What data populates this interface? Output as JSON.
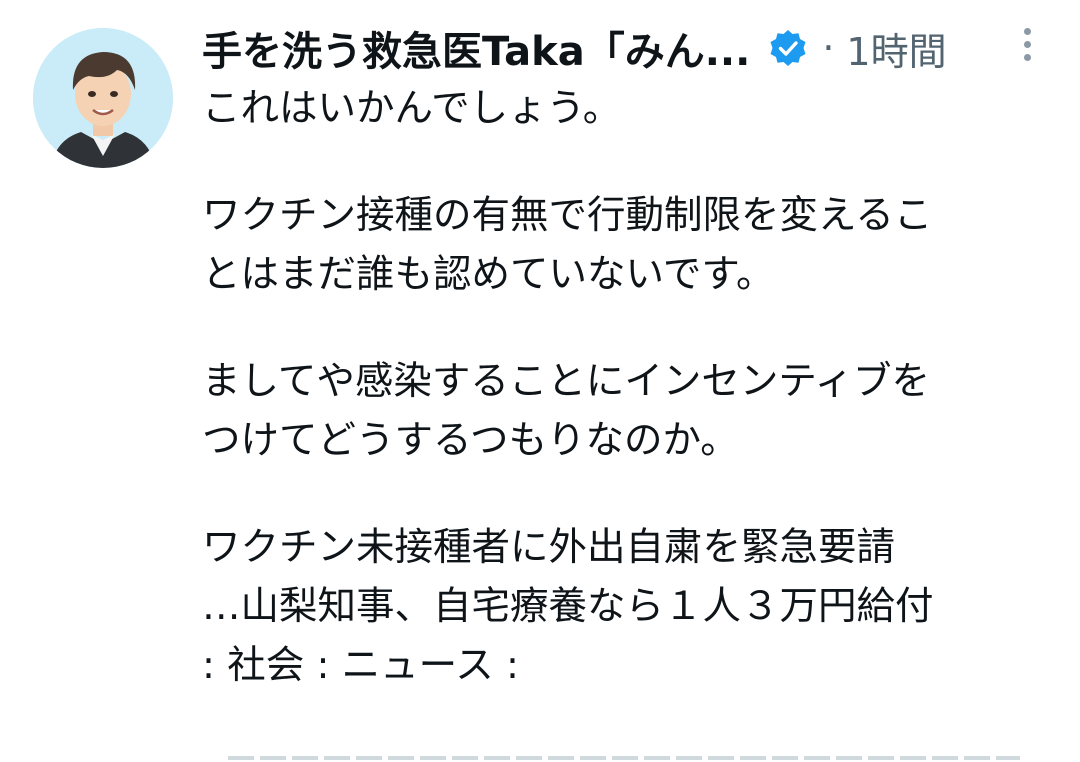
{
  "tweet": {
    "author": {
      "display_name": "手を洗う救急医Taka「みん...",
      "verified_icon": "verified-badge-icon",
      "avatar_icon": "user-avatar-illustration"
    },
    "separator": "·",
    "timestamp": "1時間",
    "more_icon": "more-options-vertical-icon",
    "lines": [
      "これはいかんでしょう。",
      "ワクチン接種の有無で行動制限を変えるこ",
      "とはまだ誰も認めていないです。",
      "ましてや感染することにインセンティブを",
      "つけてどうするつもりなのか。",
      "ワクチン未接種者に外出自粛を緊急要請",
      "…山梨知事、自宅療養なら１人３万円給付",
      ": 社会 : ニュース :"
    ]
  },
  "colors": {
    "text": "#0f1419",
    "secondary": "#536471",
    "verified_blue": "#1d9bf0",
    "avatar_bg": "#c9ecf8"
  }
}
